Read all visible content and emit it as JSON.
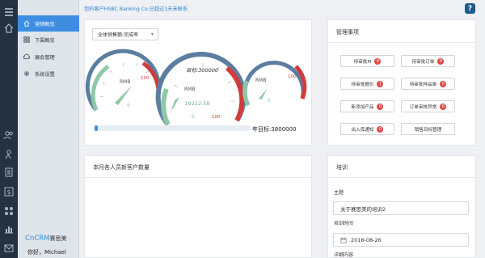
{
  "notice": "您的客户HSBC Banking Co.已超过1天未联系",
  "help_label": "?",
  "sidebar": {
    "items": [
      {
        "label": "营销概览",
        "icon": "home-icon"
      },
      {
        "label": "下属概览",
        "icon": "grid-icon"
      },
      {
        "label": "展会管理",
        "icon": "cloud-icon"
      },
      {
        "label": "系统设置",
        "icon": "gear-icon"
      }
    ],
    "brand_en": "CnCRM",
    "brand_cn": "赛思美",
    "greeting": "你好，Michael"
  },
  "rail_icons": [
    "home-icon",
    "users-icon",
    "person-icon",
    "document-icon",
    "dollar-icon",
    "grid-icon",
    "chart-icon",
    "mail-icon"
  ],
  "sales": {
    "select_value": "全体销售额-完成率",
    "gauges": [
      {
        "unit": "RMB",
        "min_label": "0",
        "max_label": "100",
        "value": 30
      },
      {
        "unit": "RMB",
        "target_label": "目标:300000",
        "reading": "19212.58",
        "min_label": "0",
        "max_label": "100",
        "value": 8
      },
      {
        "unit": "RMB",
        "min_label": "0",
        "max_label": "100",
        "value": 22
      }
    ],
    "progress": 0.02,
    "target_text": "年目标:3800000"
  },
  "manage": {
    "title": "管理事项",
    "buttons": [
      {
        "label": "待审批PI",
        "badge": "0"
      },
      {
        "label": "待审批订单",
        "badge": "0"
      },
      {
        "label": "待审批报价",
        "badge": "1"
      },
      {
        "label": "待审批样品单",
        "badge": "0"
      },
      {
        "label": "新添加产品",
        "badge": "0"
      },
      {
        "label": "订单审核异常",
        "badge": "6"
      },
      {
        "label": "出入库通知",
        "badge": "0"
      },
      {
        "label": "销售目标管理",
        "badge": ""
      }
    ]
  },
  "newcustomers": {
    "title": "本月各人员新客户数量"
  },
  "training": {
    "title": "培训",
    "subject_label": "主题",
    "subject_value": "关于赛思美的培训2",
    "time_label": "培训时间",
    "time_value": "2018-08-26",
    "detail_label": "详细内容"
  },
  "colors": {
    "accent": "#3d8ee0",
    "rail": "#253241",
    "gauge_blue": "#5b7ea0",
    "gauge_green": "#8fc8a8",
    "gauge_red": "#d23b3b",
    "badge": "#e04a4a"
  }
}
